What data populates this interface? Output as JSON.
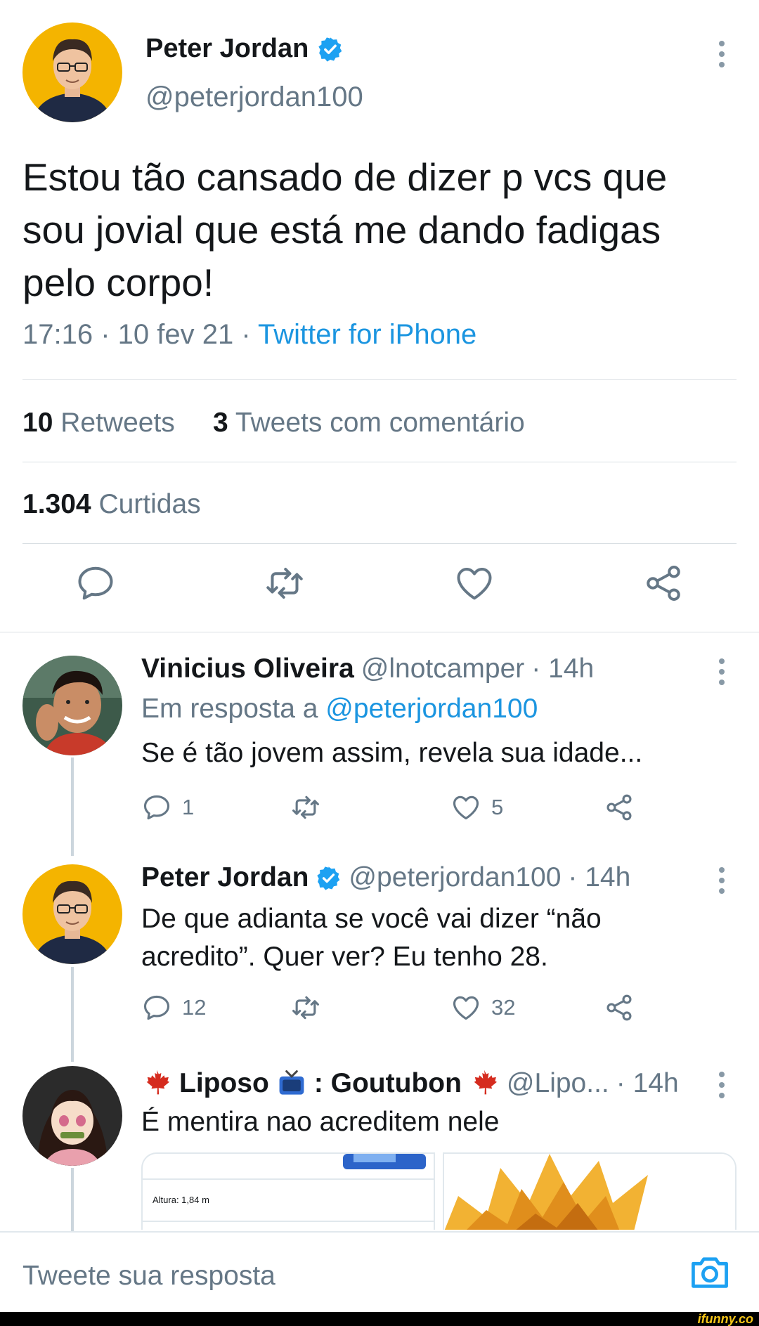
{
  "main_tweet": {
    "author_name": "Peter Jordan",
    "handle": "@peterjordan100",
    "text": "Estou tão cansado de dizer p vcs que sou jovial que está me dando fadigas pelo corpo!",
    "time": "17:16 · 10 fev 21 · ",
    "client": "Twitter for iPhone",
    "retweets_count": "10",
    "retweets_label": "Retweets",
    "quotes_count": "3",
    "quotes_label": "Tweets com comentário",
    "likes_count": "1.304",
    "likes_label": "Curtidas"
  },
  "replies": [
    {
      "author_name": "Vinicius Oliveira",
      "handle": "@lnotcamper",
      "time": "· 14h",
      "reply_to_label": "Em resposta a",
      "reply_to_handle": "@peterjordan100",
      "text": "Se é tão jovem assim, revela sua idade...",
      "reply_count": "1",
      "like_count": "5"
    },
    {
      "author_name": "Peter Jordan",
      "handle": "@peterjordan100",
      "time": "· 14h",
      "text": "De que adianta se você vai dizer “não acredito”. Quer ver? Eu tenho 28.",
      "reply_count": "12",
      "like_count": "32"
    },
    {
      "author_name": "Liposo",
      "author_name_suffix": ": Goutubon",
      "handle": "@Lipo...",
      "time": "· 14h",
      "text": "É mentira nao acreditem nele",
      "media_caption": "Altura: 1,84 m"
    }
  ],
  "compose": {
    "placeholder": "Tweete sua resposta"
  },
  "watermark": "ifunny.co",
  "icons": {
    "verified": "verified-badge-icon",
    "more": "more-vertical-icon",
    "reply": "reply-bubble-icon",
    "retweet": "retweet-icon",
    "like": "heart-icon",
    "share": "share-icon",
    "camera": "camera-icon",
    "flag": "maple-leaf-icon",
    "tv": "television-icon"
  },
  "colors": {
    "accent": "#1b95e0",
    "secondary_text": "#657786",
    "divider": "#d9dfe3"
  }
}
